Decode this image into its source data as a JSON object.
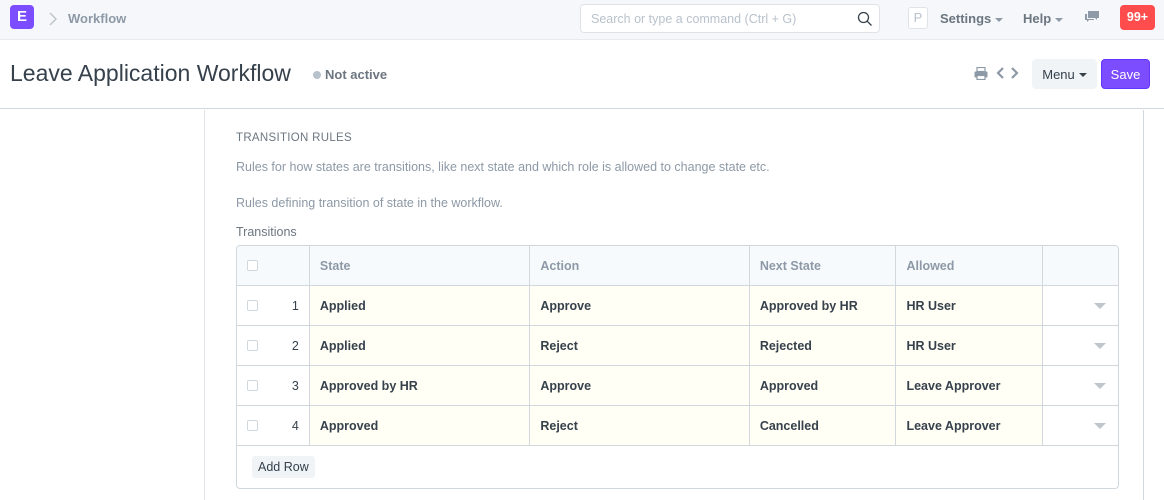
{
  "navbar": {
    "logo_letter": "E",
    "breadcrumb": "Workflow",
    "search_placeholder": "Search or type a command (Ctrl + G)",
    "avatar_letter": "P",
    "settings_label": "Settings",
    "help_label": "Help",
    "notification_count": "99+"
  },
  "page": {
    "title": "Leave Application Workflow",
    "status": "Not active",
    "menu_label": "Menu",
    "save_label": "Save"
  },
  "section": {
    "heading": "TRANSITION RULES",
    "description": "Rules for how states are transitions, like next state and which role is allowed to change state etc.",
    "field_description": "Rules defining transition of state in the workflow.",
    "field_label": "Transitions"
  },
  "table": {
    "columns": [
      "State",
      "Action",
      "Next State",
      "Allowed"
    ],
    "rows": [
      {
        "idx": "1",
        "state": "Applied",
        "action": "Approve",
        "next_state": "Approved by HR",
        "allowed": "HR User"
      },
      {
        "idx": "2",
        "state": "Applied",
        "action": "Reject",
        "next_state": "Rejected",
        "allowed": "HR User"
      },
      {
        "idx": "3",
        "state": "Approved by HR",
        "action": "Approve",
        "next_state": "Approved",
        "allowed": "Leave Approver"
      },
      {
        "idx": "4",
        "state": "Approved",
        "action": "Reject",
        "next_state": "Cancelled",
        "allowed": "Leave Approver"
      }
    ],
    "add_row_label": "Add Row"
  },
  "colors": {
    "accent": "#7c4dff",
    "badge": "#ff4d4d",
    "editable_cell_bg": "#fffff5"
  }
}
